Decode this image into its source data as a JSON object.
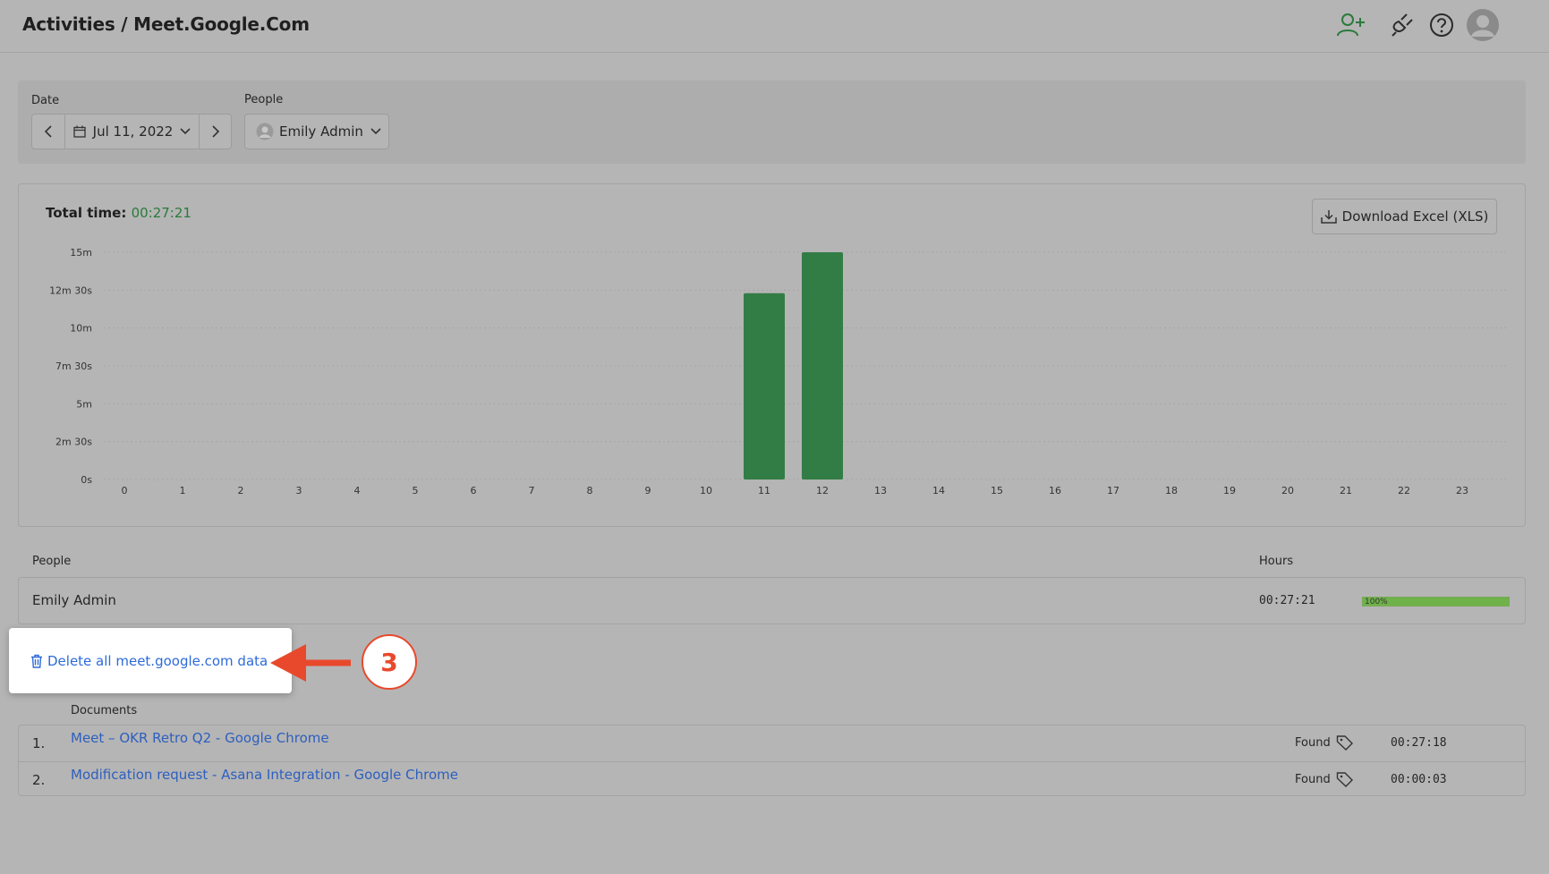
{
  "header": {
    "title": "Activities / Meet.Google.Com",
    "icons": [
      "add-user-icon",
      "plug-icon",
      "help-icon",
      "avatar"
    ]
  },
  "filters": {
    "date_label": "Date",
    "date_value": "Jul 11, 2022",
    "people_label": "People",
    "people_value": "Emily Admin"
  },
  "summary": {
    "total_label": "Total time:",
    "total_value": "00:27:21",
    "download_label": "Download Excel (XLS)"
  },
  "chart_data": {
    "type": "bar",
    "categories": [
      "0",
      "1",
      "2",
      "3",
      "4",
      "5",
      "6",
      "7",
      "8",
      "9",
      "10",
      "11",
      "12",
      "13",
      "14",
      "15",
      "16",
      "17",
      "18",
      "19",
      "20",
      "21",
      "22",
      "23"
    ],
    "values": [
      0,
      0,
      0,
      0,
      0,
      0,
      0,
      0,
      0,
      0,
      0,
      12.3,
      15,
      0,
      0,
      0,
      0,
      0,
      0,
      0,
      0,
      0,
      0,
      0
    ],
    "y_unit": "minutes",
    "y_ticks": [
      "0s",
      "2m 30s",
      "5m",
      "7m 30s",
      "10m",
      "12m 30s",
      "15m"
    ],
    "ylim": [
      0,
      15
    ],
    "grid": true,
    "bar_color": "#327d45"
  },
  "people_table": {
    "col_people": "People",
    "col_hours": "Hours",
    "rows": [
      {
        "name": "Emily Admin",
        "hours": "00:27:21",
        "percent_label": "100%",
        "percent": 100
      }
    ]
  },
  "popup": {
    "delete_label": "Delete all meet.google.com data",
    "step_number": "3"
  },
  "documents": {
    "header": "Documents",
    "rows": [
      {
        "num": "1.",
        "title": "Meet – OKR Retro Q2 - Google Chrome",
        "status": "Found",
        "time": "00:27:18"
      },
      {
        "num": "2.",
        "title": "Modification request - Asana Integration - Google Chrome",
        "status": "Found",
        "time": "00:00:03"
      }
    ]
  },
  "colors": {
    "accent_green": "#2a7a3b",
    "link_blue": "#2d6bd9",
    "callout_red": "#e8492d"
  }
}
